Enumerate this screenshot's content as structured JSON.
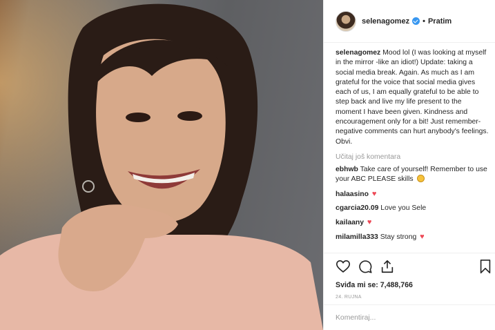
{
  "header": {
    "username": "selenagomez",
    "separator": "•",
    "follow_label": "Pratim"
  },
  "caption": {
    "username": "selenagomez",
    "text": "Mood lol (I was looking at myself in the mirror -like an idiot!) Update: taking a social media break. Again. As much as I am grateful for the voice that social media gives each of us, I am equally grateful to be able to step back and live my life present to the moment I have been given. Kindness and encouragement only for a bit! Just remember- negative comments can hurt anybody's feelings. Obvi."
  },
  "load_more_label": "Učitaj još komentara",
  "comments": [
    {
      "username": "ebhwb",
      "text": "Take care of yourself! Remember to use your ABC PLEASE skills",
      "emoji": "smile-emoji"
    },
    {
      "username": "halaasino",
      "text": "",
      "emoji": "heart"
    },
    {
      "username": "cgarcia20.09",
      "text": "Love you Sele",
      "emoji": ""
    },
    {
      "username": "kailaany",
      "text": "",
      "emoji": "heart"
    },
    {
      "username": "milamilla333",
      "text": "Stay strong",
      "emoji": "heart"
    }
  ],
  "heart_glyph": "♥",
  "actions": {
    "icons": [
      "heart-icon",
      "comment-icon",
      "share-icon",
      "bookmark-icon"
    ],
    "likes_text": "Sviđa mi se: 7,488,766",
    "date": "24. RUJNA"
  },
  "comment_input": {
    "placeholder": "Komentiraj..."
  },
  "colors": {
    "verified": "#3897f0",
    "heart": "#ed4956",
    "muted": "#999999",
    "border": "#efefef"
  }
}
